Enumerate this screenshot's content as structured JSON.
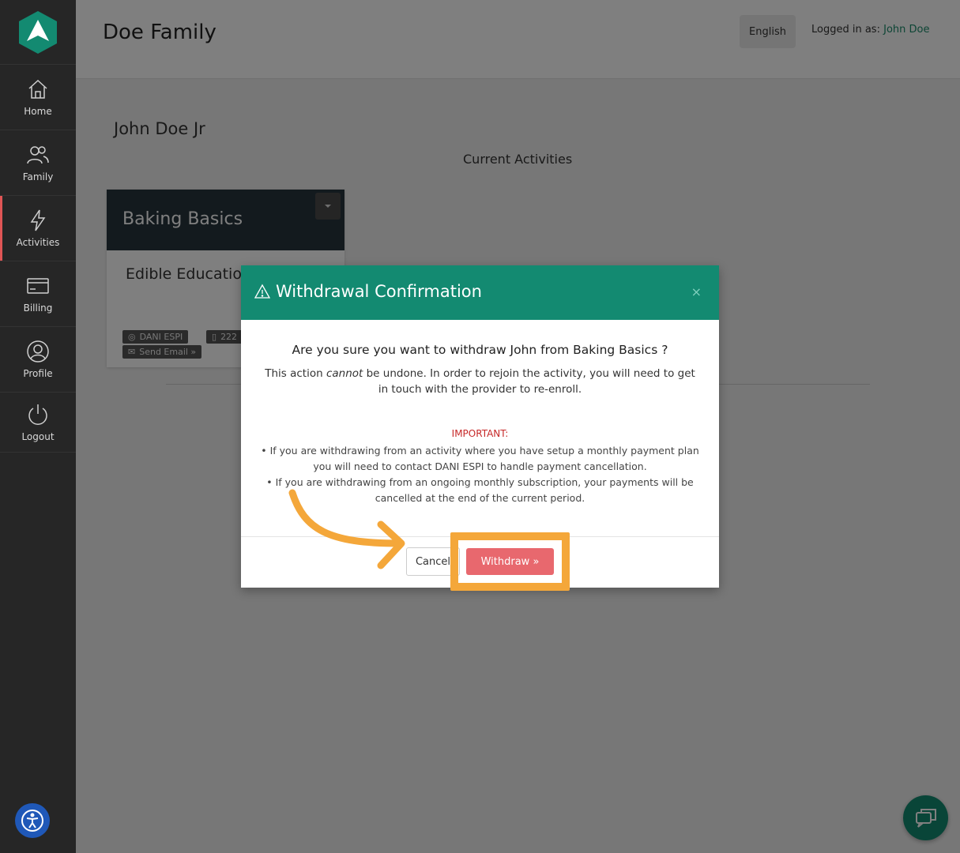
{
  "nav": {
    "items": [
      {
        "label": "Home",
        "icon": "home-icon"
      },
      {
        "label": "Family",
        "icon": "family-icon"
      },
      {
        "label": "Activities",
        "icon": "lightning-icon"
      },
      {
        "label": "Billing",
        "icon": "credit-card-icon"
      },
      {
        "label": "Profile",
        "icon": "profile-icon"
      },
      {
        "label": "Logout",
        "icon": "power-icon"
      }
    ],
    "active": "Activities"
  },
  "header": {
    "title": "Doe Family",
    "language": "English",
    "logged_in_prefix": "Logged in as:",
    "user": "John Doe"
  },
  "main": {
    "child_name": "John Doe Jr",
    "section_title": "Current Activities",
    "card": {
      "title": "Baking Basics",
      "provider": "Edible Educatio",
      "contact_name": "DANI ESPI",
      "phone": "222",
      "send_email": "Send Email »"
    }
  },
  "modal": {
    "title": "Withdrawal Confirmation",
    "close": "×",
    "question": "Are you sure you want to withdraw John from Baking Basics ?",
    "desc_before": "This action ",
    "desc_em": "cannot",
    "desc_after": " be undone. In order to rejoin the activity, you will need to get in touch with the provider to re-enroll.",
    "important": "IMPORTANT:",
    "note1": "• If you are withdrawing from an activity where you have setup a monthly payment plan you will need to contact DANI ESPI to handle payment cancellation.",
    "note2": "• If you are withdrawing from an ongoing monthly subscription, your payments will be cancelled at the end of the current period.",
    "cancel": "Cancel",
    "withdraw": "Withdraw »"
  },
  "colors": {
    "brand_green": "#138a71",
    "sidebar": "#262626",
    "withdraw": "#e8686e",
    "highlight": "#f4a73a",
    "important": "#c62828"
  }
}
